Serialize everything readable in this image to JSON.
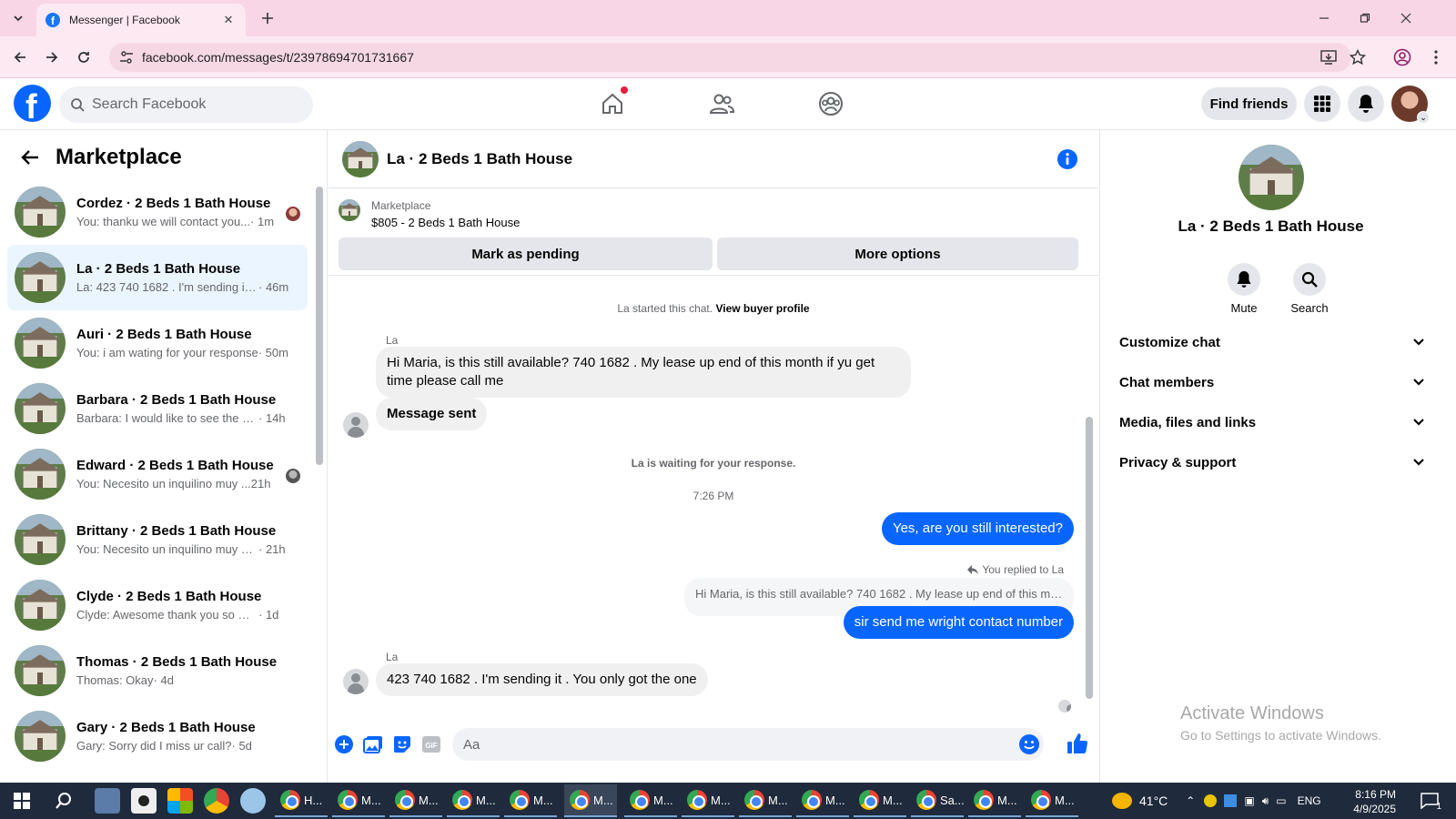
{
  "browser": {
    "tab_title": "Messenger | Facebook",
    "url": "facebook.com/messages/t/23978694701731667"
  },
  "header": {
    "search_placeholder": "Search Facebook",
    "find_friends": "Find friends"
  },
  "left": {
    "title": "Marketplace",
    "conversations": [
      {
        "name": "Cordez · 2 Beds 1 Bath House",
        "snippet": "You: thanku we will contact you...",
        "time": " · 1m"
      },
      {
        "name": "La · 2 Beds 1 Bath House",
        "snippet": "La: 423 740 1682 . I'm sending it ....",
        "time": " · 46m"
      },
      {
        "name": "Auri · 2 Beds 1 Bath House",
        "snippet": "You: i am wating for your response",
        "time": " · 50m"
      },
      {
        "name": "Barbara · 2 Beds 1 Bath House",
        "snippet": "Barbara: I would like to see the ho...",
        "time": " · 14h"
      },
      {
        "name": "Edward · 2 Beds 1 Bath House",
        "snippet": "You: Necesito un inquilino muy ...",
        "time": " 21h"
      },
      {
        "name": "Brittany · 2 Beds 1 Bath House",
        "snippet": "You: Necesito un inquilino muy bu...",
        "time": " · 21h"
      },
      {
        "name": "Clyde · 2 Beds 1 Bath House",
        "snippet": "Clyde: Awesome thank you so muc...",
        "time": " · 1d"
      },
      {
        "name": "Thomas · 2 Beds 1 Bath House",
        "snippet": "Thomas: Okay",
        "time": " · 4d"
      },
      {
        "name": "Gary · 2 Beds 1 Bath House",
        "snippet": "Gary: Sorry did I miss ur call?",
        "time": " · 5d"
      }
    ]
  },
  "chat": {
    "title": "La · 2 Beds 1 Bath House",
    "listing_label": "Marketplace",
    "listing_price": "$805 - 2 Beds 1 Bath House",
    "mark_pending": "Mark as pending",
    "more_options": "More options",
    "started_prefix": "La started this chat.",
    "view_profile": "View buyer profile",
    "sender1": "La",
    "msg1": "Hi Maria, is this still available? 740 1682 . My lease up end of this month if yu get time please call me",
    "msg2": "Message sent",
    "waiting": "La is waiting for your response.",
    "timestamp": "7:26 PM",
    "out1": "Yes, are you still interested?",
    "replied": "You replied to La",
    "quote": "Hi Maria, is this still available? 740 1682 . My lease up end of this mo...",
    "out2": "sir send me wright contact number",
    "sender2": "La",
    "msg3": "423 740 1682 . I'm sending it . You only got the one",
    "composer_placeholder": "Aa"
  },
  "right": {
    "name": "La · 2 Beds 1 Bath House",
    "mute": "Mute",
    "search": "Search",
    "sections": [
      "Customize chat",
      "Chat members",
      "Media, files and links",
      "Privacy & support"
    ],
    "activate_title": "Activate Windows",
    "activate_sub": "Go to Settings to activate Windows."
  },
  "taskbar": {
    "apps": [
      "H...",
      "M...",
      "M...",
      "M...",
      "M...",
      "M...",
      "M...",
      "M...",
      "M...",
      "M...",
      "M...",
      "Sa...",
      "M...",
      "M..."
    ],
    "weather": "41°C",
    "lang": "ENG",
    "time": "8:16 PM",
    "date": "4/9/2025",
    "notif_count": "1"
  },
  "colors": {
    "fb_blue": "#0866ff",
    "tab_bg": "#f8d6e6",
    "active_conv": "#ebf5ff",
    "taskbar": "#1f2a3c"
  },
  "icons": [
    "facebook-logo-icon",
    "home-icon",
    "friends-icon",
    "groups-icon",
    "menu-grid-icon",
    "bell-icon",
    "info-icon",
    "plus-icon",
    "image-icon",
    "sticker-icon",
    "gif-icon",
    "emoji-icon",
    "like-icon",
    "search-icon",
    "chevron-down-icon"
  ]
}
